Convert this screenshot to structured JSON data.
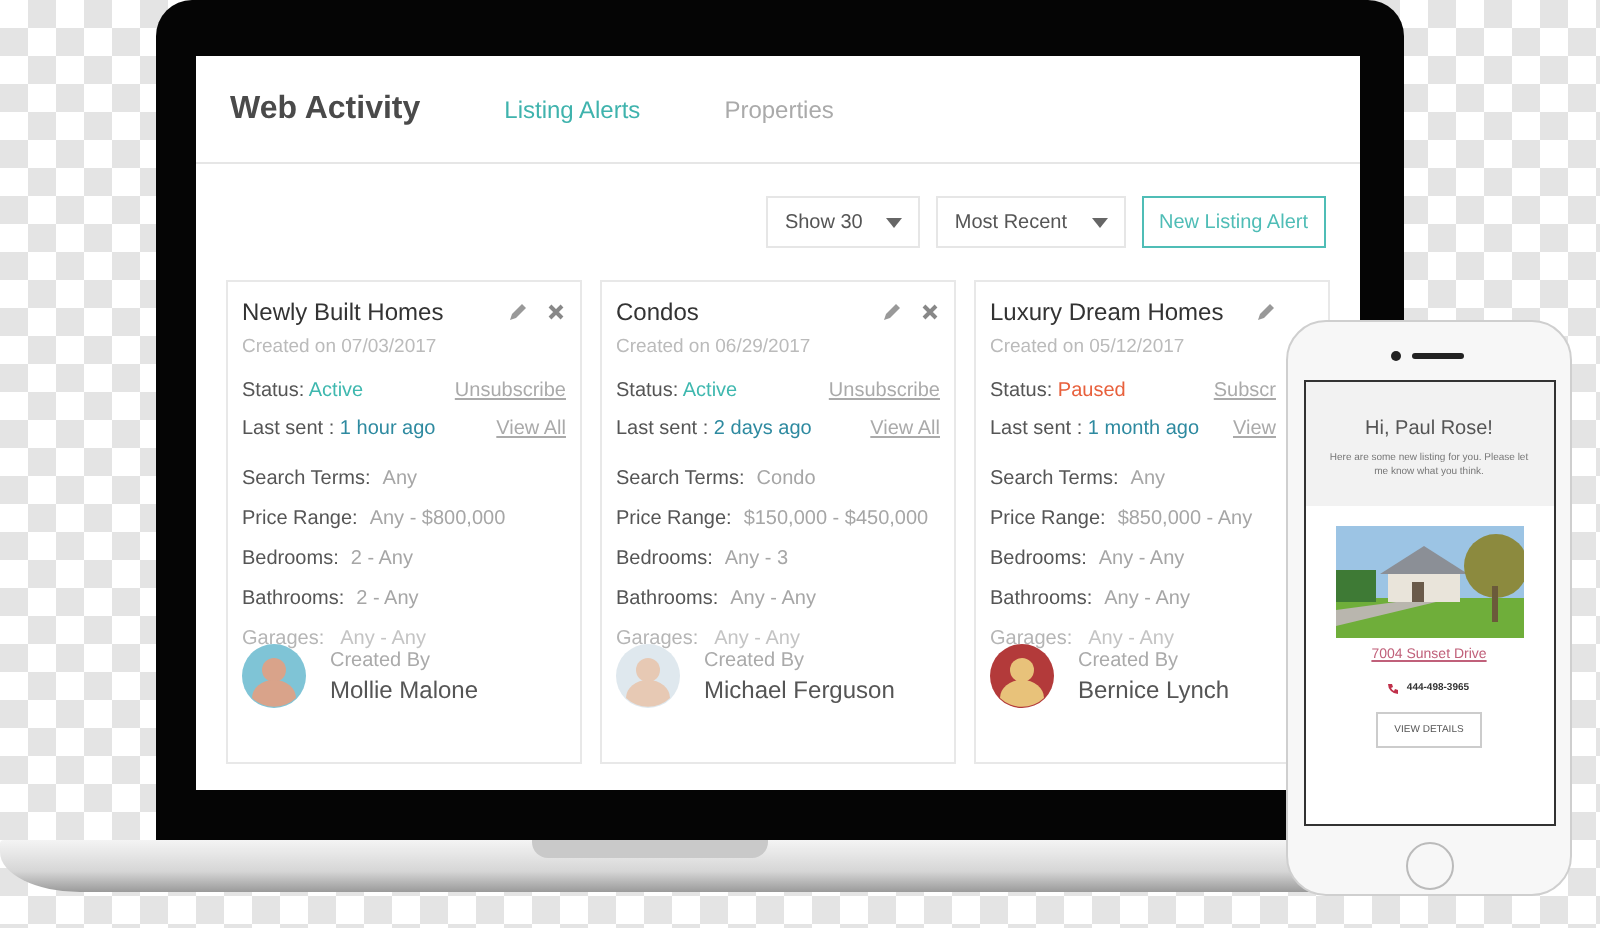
{
  "header": {
    "title": "Web Activity"
  },
  "tabs": [
    {
      "label": "Listing Alerts",
      "selected": true
    },
    {
      "label": "Properties",
      "selected": false
    }
  ],
  "toolbar": {
    "selects": [
      "Show 30",
      "Most Recent"
    ],
    "button": "New Listing Alert"
  },
  "cards": [
    {
      "title": "Newly Built Homes",
      "created": "Created on 07/03/2017",
      "close_icon": true,
      "status_label": "Status:",
      "status": "Active",
      "color": "#3fb8af",
      "action": "Unsubscribe",
      "last_sent_label": "Last sent :",
      "last_sent": "1 hour ago",
      "view": "View All",
      "details": [
        {
          "label": "Search Terms:",
          "value": "Any"
        },
        {
          "label": "Price Range:",
          "value": "Any - $800,000"
        },
        {
          "label": "Bedrooms:",
          "value": "2 - Any"
        },
        {
          "label": "Bathrooms:",
          "value": "2 - Any"
        }
      ],
      "faded": {
        "label": "Garages:",
        "value": "Any - Any"
      },
      "created_by_label": "Created By",
      "author": "Mollie Malone"
    },
    {
      "title": "Condos",
      "created": "Created on 06/29/2017",
      "close_icon": true,
      "status_label": "Status:",
      "status": "Active",
      "color": "#3fb8af",
      "action": "Unsubscribe",
      "last_sent_label": "Last sent :",
      "last_sent": "2 days ago",
      "view": "View All",
      "details": [
        {
          "label": "Search Terms:",
          "value": "Condo"
        },
        {
          "label": "Price Range:",
          "value": "$150,000 - $450,000"
        },
        {
          "label": "Bedrooms:",
          "value": "Any - 3"
        },
        {
          "label": "Bathrooms:",
          "value": "Any - Any"
        }
      ],
      "faded": {
        "label": "Garages:",
        "value": "Any - Any"
      },
      "created_by_label": "Created By",
      "author": "Michael Ferguson"
    },
    {
      "title": "Luxury Dream Homes",
      "created": "Created on 05/12/2017",
      "close_icon": false,
      "status_label": "Status:",
      "status": "Paused",
      "color": "#e8603c",
      "action": "Subscr",
      "last_sent_label": "Last sent :",
      "last_sent": "1 month ago",
      "view": "View",
      "details": [
        {
          "label": "Search Terms:",
          "value": "Any"
        },
        {
          "label": "Price Range:",
          "value": "$850,000 - Any"
        },
        {
          "label": "Bedrooms:",
          "value": "Any - Any"
        },
        {
          "label": "Bathrooms:",
          "value": "Any - Any"
        }
      ],
      "faded": {
        "label": "Garages:",
        "value": "Any - Any"
      },
      "created_by_label": "Created By",
      "author": "Bernice Lynch"
    }
  ],
  "phone": {
    "greeting": "Hi, Paul Rose!",
    "message": "Here are some new listing for you. Please let me know what you think.",
    "address": "7004 Sunset Drive",
    "phone_number": "444-498-3965",
    "button": "VIEW DETAILS"
  }
}
